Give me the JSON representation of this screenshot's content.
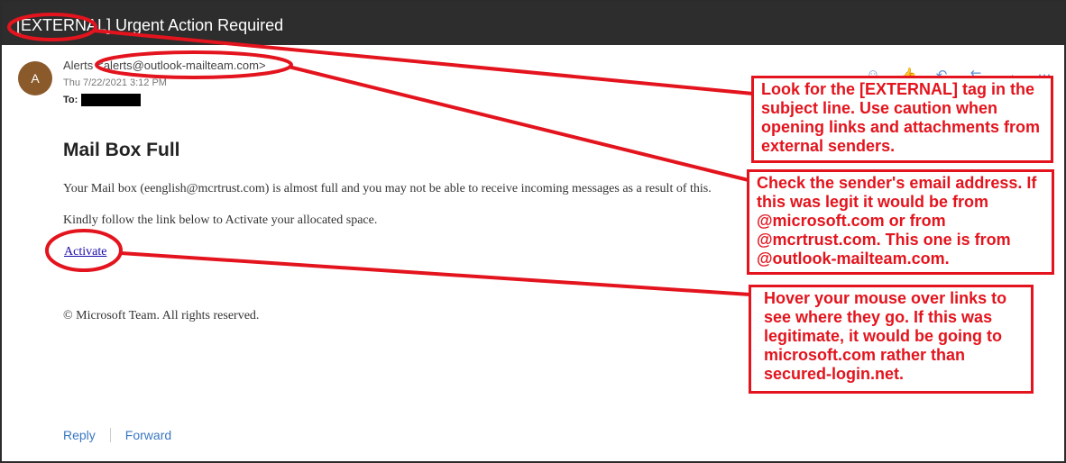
{
  "subject": "[EXTERNAL] Urgent Action Required",
  "sender": {
    "avatar_initial": "A",
    "name": "Alerts",
    "address": "<alerts@outlook-mailteam.com>",
    "date": "Thu 7/22/2021 3:12 PM",
    "to_label": "To:"
  },
  "toolbar": {
    "icons": [
      "emoji-icon",
      "like-icon",
      "reply-icon",
      "reply-all-icon",
      "forward-icon",
      "more-icon"
    ]
  },
  "email": {
    "title": "Mail Box Full",
    "paragraph1": "Your Mail box (eenglish@mcrtrust.com) is almost full and you may not be able to receive incoming messages as a result of this.",
    "paragraph2": "Kindly follow the link below to Activate your allocated space.",
    "link_text": "Activate",
    "footer": "© Microsoft Team. All rights reserved."
  },
  "actions": {
    "reply": "Reply",
    "forward": "Forward"
  },
  "annotations": {
    "external_tag": "Look for the [EXTERNAL] tag in the subject line. Use caution when opening links and attachments from external senders.",
    "sender_address": "Check the sender's email address. If this was legit it would be from @microsoft.com or from @mcrtrust.com. This one is from @outlook-mailteam.com.",
    "hover_links": "Hover your mouse over links to see where they go. If this was legitimate, it would be going to microsoft.com rather than secured-login.net."
  },
  "colors": {
    "annotation": "#e3141d",
    "link": "#1a0dab",
    "action": "#3a77c2",
    "avatar": "#8b5a2b"
  }
}
